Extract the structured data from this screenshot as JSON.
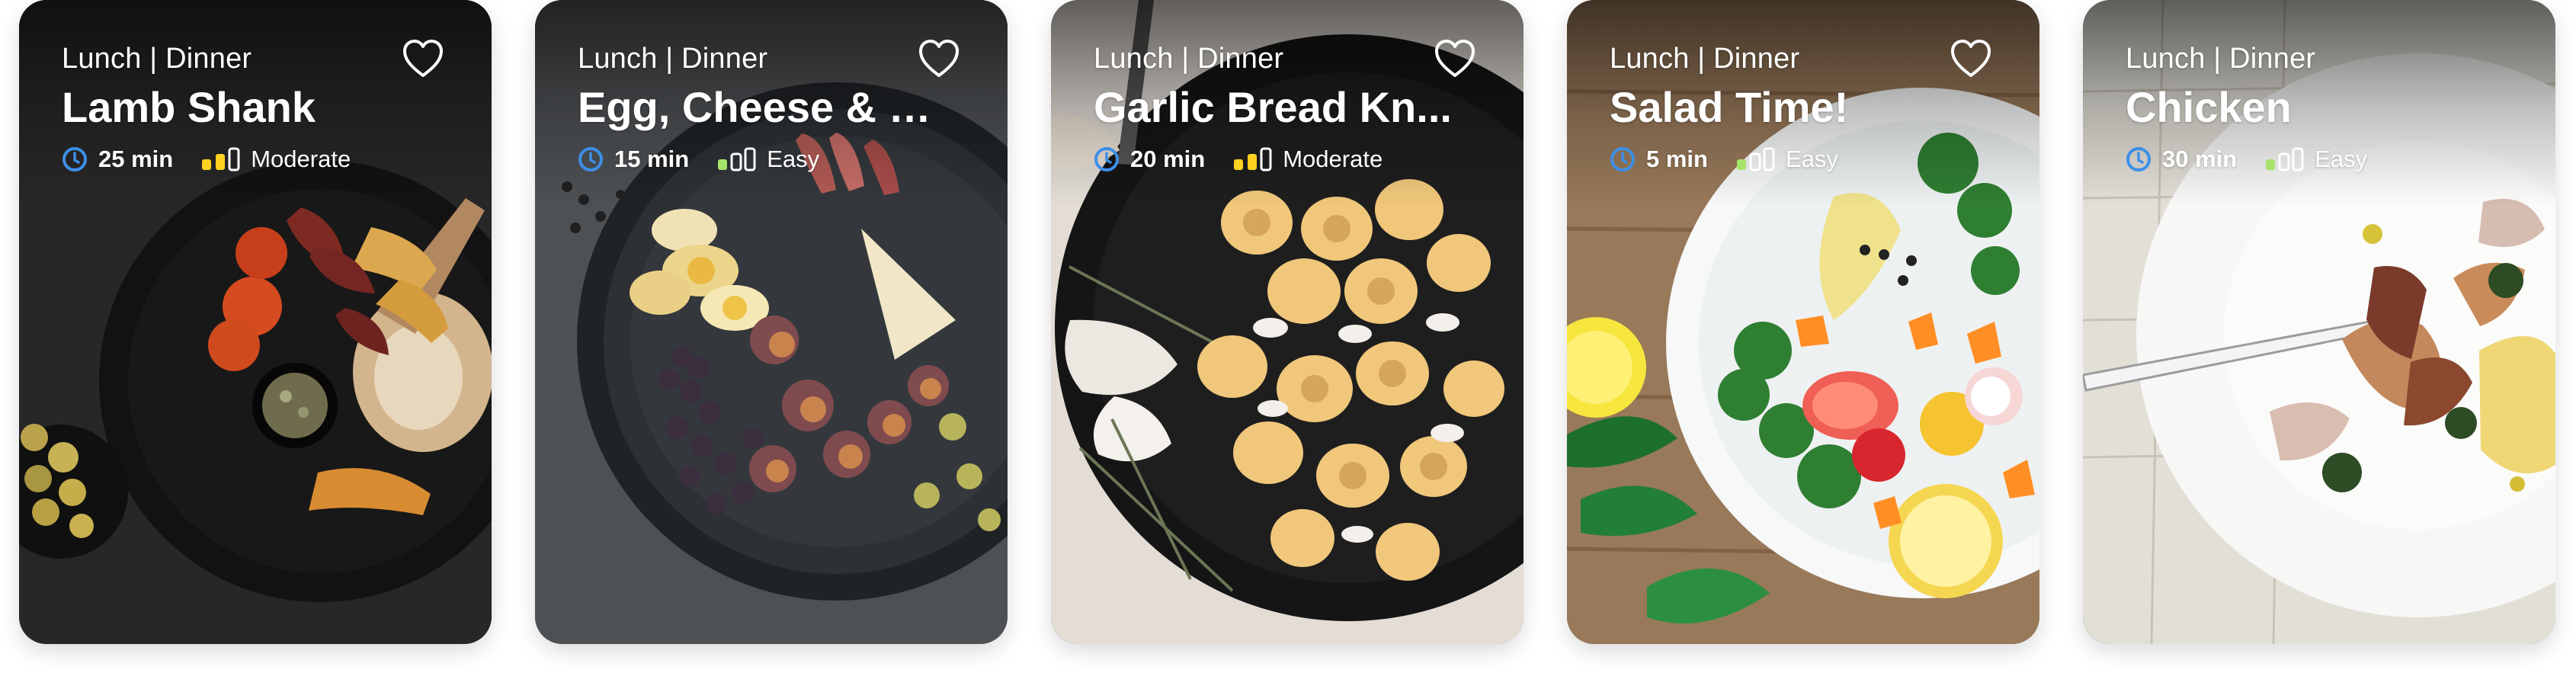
{
  "colors": {
    "clock": "#3d8fe6",
    "moderate": "#ffd21f",
    "easy": "#a6e36a",
    "inactive_bar": "#ffffff",
    "heart": "#ffffff"
  },
  "icons": {
    "favorite": "heart-outline-icon",
    "time": "clock-icon",
    "difficulty": "difficulty-bars-icon"
  },
  "cards": [
    {
      "meal_type": "Lunch | Dinner",
      "title": "Lamb Shank",
      "time": "25 min",
      "difficulty": "Moderate",
      "difficulty_level": 2
    },
    {
      "meal_type": "Lunch | Dinner",
      "title": "Egg, Cheese & F...",
      "time": "15 min",
      "difficulty": "Easy",
      "difficulty_level": 1
    },
    {
      "meal_type": "Lunch | Dinner",
      "title": "Garlic Bread Kn...",
      "time": "20 min",
      "difficulty": "Moderate",
      "difficulty_level": 2
    },
    {
      "meal_type": "Lunch | Dinner",
      "title": "Salad Time!",
      "time": "5 min",
      "difficulty": "Easy",
      "difficulty_level": 1
    },
    {
      "meal_type": "Lunch | Dinner",
      "title": "Chicken",
      "time": "30 min",
      "difficulty": "Easy",
      "difficulty_level": 1
    }
  ]
}
